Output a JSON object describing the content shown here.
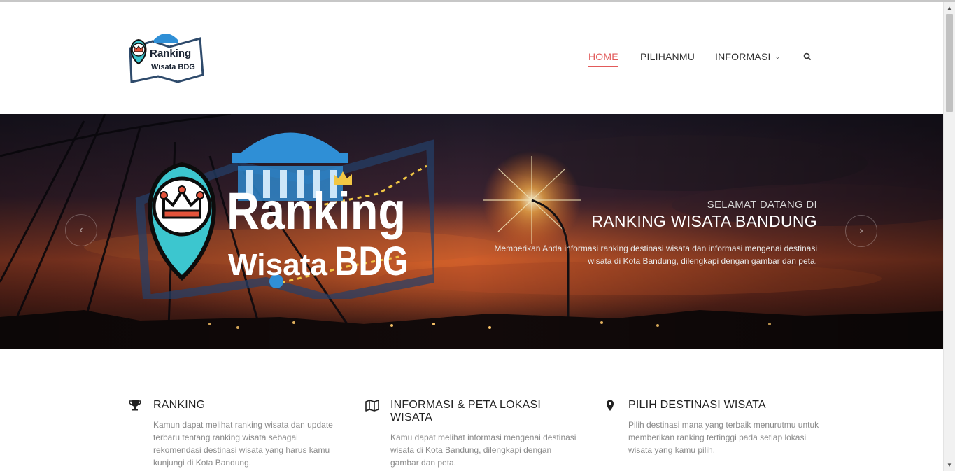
{
  "header": {
    "logo_text_line1": "Ranking",
    "logo_text_line2": "Wisata BDG"
  },
  "nav": {
    "items": [
      {
        "label": "HOME",
        "active": true
      },
      {
        "label": "PILIHANMU",
        "active": false
      },
      {
        "label": "INFORMASI",
        "active": false
      }
    ],
    "search_icon": "search-icon"
  },
  "hero": {
    "logo_line1": "Ranking",
    "logo_line2_a": "Wisata",
    "logo_line2_b": "BDG",
    "subtitle": "SELAMAT DATANG DI",
    "title": "RANKING WISATA BANDUNG",
    "description": "Memberikan Anda informasi ranking destinasi wisata dan informasi mengenai destinasi wisata di Kota Bandung, dilengkapi dengan gambar dan peta.",
    "prev_icon": "chevron-left-icon",
    "next_icon": "chevron-right-icon"
  },
  "features": [
    {
      "icon": "trophy-icon",
      "title": "RANKING",
      "description": "Kamun dapat melihat ranking wisata dan update terbaru tentang ranking wisata sebagai rekomendasi destinasi wisata yang harus kamu kunjungi di Kota Bandung."
    },
    {
      "icon": "map-icon",
      "title": "INFORMASI & PETA LOKASI WISATA",
      "description": "Kamu dapat melihat informasi mengenai destinasi wisata di Kota Bandung, dilengkapi dengan gambar dan peta."
    },
    {
      "icon": "map-marker-icon",
      "title": "PILIH DESTINASI WISATA",
      "description": "Pilih destinasi mana yang terbaik menurutmu untuk memberikan ranking tertinggi pada setiap lokasi wisata yang kamu pilih."
    }
  ],
  "colors": {
    "accent": "#e25a5a",
    "logo_teal": "#3cc6cf",
    "logo_blue": "#2f8fd6",
    "logo_navy": "#2e4a6b"
  }
}
